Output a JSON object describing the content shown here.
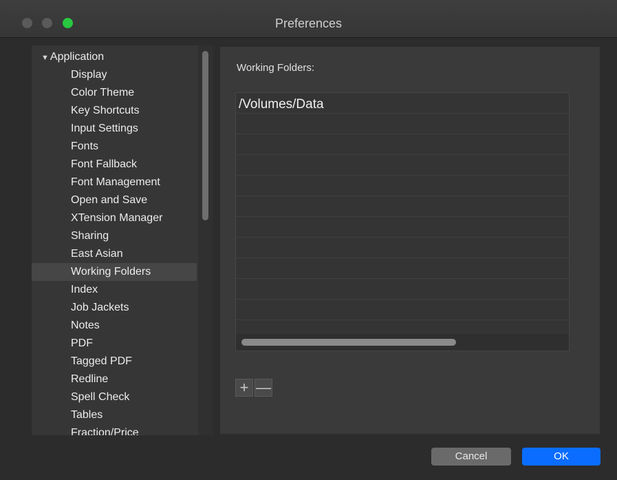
{
  "window": {
    "title": "Preferences"
  },
  "sidebar": {
    "items": [
      {
        "label": "Application",
        "disclosure": "▼",
        "parent": true
      },
      {
        "label": "Display"
      },
      {
        "label": "Color Theme"
      },
      {
        "label": "Key Shortcuts"
      },
      {
        "label": "Input Settings"
      },
      {
        "label": "Fonts"
      },
      {
        "label": "Font Fallback"
      },
      {
        "label": "Font Management"
      },
      {
        "label": "Open and Save"
      },
      {
        "label": "XTension Manager"
      },
      {
        "label": "Sharing"
      },
      {
        "label": "East Asian"
      },
      {
        "label": "Working Folders",
        "selected": true
      },
      {
        "label": "Index"
      },
      {
        "label": "Job Jackets"
      },
      {
        "label": "Notes"
      },
      {
        "label": "PDF"
      },
      {
        "label": "Tagged PDF"
      },
      {
        "label": "Redline"
      },
      {
        "label": "Spell Check"
      },
      {
        "label": "Tables"
      },
      {
        "label": "Fraction/Price"
      }
    ]
  },
  "main": {
    "heading": "Working Folders:",
    "folders": [
      "/Volumes/Data"
    ],
    "add_symbol": "+",
    "remove_symbol": "—"
  },
  "footer": {
    "cancel_label": "Cancel",
    "ok_label": "OK"
  },
  "colors": {
    "accent": "#0a6dff",
    "selection": "#464646",
    "zoom_light": "#28c840"
  }
}
